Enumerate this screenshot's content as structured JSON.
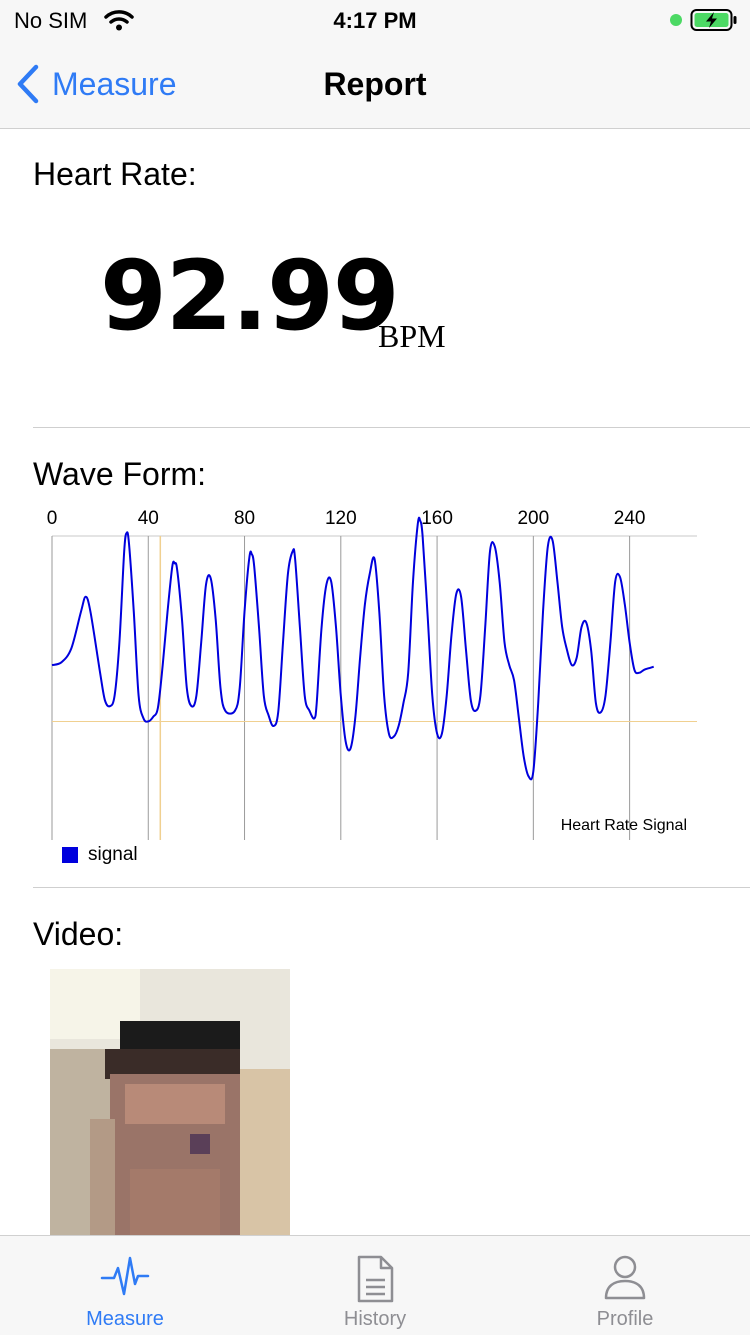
{
  "status_bar": {
    "carrier": "No SIM",
    "time": "4:17 PM"
  },
  "nav": {
    "back_label": "Measure",
    "title": "Report"
  },
  "heart_rate": {
    "label": "Heart Rate:",
    "value": "92.99",
    "unit": "BPM"
  },
  "wave_form": {
    "label": "Wave Form:"
  },
  "video": {
    "label": "Video:"
  },
  "chart_data": {
    "type": "line",
    "title": "Heart Rate Signal",
    "x_ticks": [
      0,
      40,
      80,
      120,
      160,
      200,
      240
    ],
    "xlim": [
      0,
      268
    ],
    "ylim": [
      -1.0,
      1.0
    ],
    "baseline": -0.22,
    "marker_x": 45,
    "legend_position": "bottom-left",
    "series": [
      {
        "name": "signal",
        "color": "#0000dd",
        "points": [
          [
            0,
            0.15
          ],
          [
            4,
            0.17
          ],
          [
            8,
            0.26
          ],
          [
            12,
            0.5
          ],
          [
            14,
            0.6
          ],
          [
            16,
            0.5
          ],
          [
            20,
            0.1
          ],
          [
            22,
            -0.08
          ],
          [
            24,
            -0.12
          ],
          [
            26,
            -0.05
          ],
          [
            28,
            0.3
          ],
          [
            30,
            0.9
          ],
          [
            31,
            1.02
          ],
          [
            32,
            0.95
          ],
          [
            34,
            0.5
          ],
          [
            36,
            -0.05
          ],
          [
            38,
            -0.2
          ],
          [
            40,
            -0.22
          ],
          [
            42,
            -0.19
          ],
          [
            44,
            -0.13
          ],
          [
            46,
            0.15
          ],
          [
            48,
            0.5
          ],
          [
            50,
            0.8
          ],
          [
            51,
            0.82
          ],
          [
            52,
            0.78
          ],
          [
            54,
            0.45
          ],
          [
            56,
            0.0
          ],
          [
            58,
            -0.12
          ],
          [
            60,
            -0.05
          ],
          [
            62,
            0.3
          ],
          [
            64,
            0.68
          ],
          [
            66,
            0.72
          ],
          [
            68,
            0.45
          ],
          [
            70,
            0.0
          ],
          [
            72,
            -0.15
          ],
          [
            76,
            -0.15
          ],
          [
            78,
            0.0
          ],
          [
            80,
            0.5
          ],
          [
            82,
            0.86
          ],
          [
            83,
            0.88
          ],
          [
            84,
            0.8
          ],
          [
            86,
            0.4
          ],
          [
            88,
            -0.05
          ],
          [
            90,
            -0.18
          ],
          [
            92,
            -0.25
          ],
          [
            94,
            -0.16
          ],
          [
            96,
            0.3
          ],
          [
            98,
            0.75
          ],
          [
            100,
            0.9
          ],
          [
            101,
            0.85
          ],
          [
            103,
            0.4
          ],
          [
            105,
            -0.05
          ],
          [
            107,
            -0.15
          ],
          [
            109,
            -0.2
          ],
          [
            110,
            -0.1
          ],
          [
            112,
            0.4
          ],
          [
            114,
            0.68
          ],
          [
            116,
            0.7
          ],
          [
            118,
            0.4
          ],
          [
            120,
            -0.05
          ],
          [
            122,
            -0.35
          ],
          [
            124,
            -0.4
          ],
          [
            126,
            -0.2
          ],
          [
            128,
            0.2
          ],
          [
            130,
            0.55
          ],
          [
            132,
            0.75
          ],
          [
            134,
            0.85
          ],
          [
            136,
            0.5
          ],
          [
            138,
            -0.05
          ],
          [
            140,
            -0.3
          ],
          [
            142,
            -0.32
          ],
          [
            144,
            -0.25
          ],
          [
            146,
            -0.1
          ],
          [
            148,
            0.1
          ],
          [
            150,
            0.7
          ],
          [
            152,
            1.08
          ],
          [
            153,
            1.1
          ],
          [
            154,
            1.0
          ],
          [
            156,
            0.5
          ],
          [
            158,
            -0.05
          ],
          [
            160,
            -0.3
          ],
          [
            162,
            -0.3
          ],
          [
            164,
            -0.05
          ],
          [
            166,
            0.35
          ],
          [
            168,
            0.62
          ],
          [
            170,
            0.6
          ],
          [
            172,
            0.25
          ],
          [
            174,
            -0.08
          ],
          [
            176,
            -0.15
          ],
          [
            178,
            -0.05
          ],
          [
            180,
            0.4
          ],
          [
            182,
            0.9
          ],
          [
            184,
            0.93
          ],
          [
            186,
            0.7
          ],
          [
            188,
            0.3
          ],
          [
            190,
            0.15
          ],
          [
            192,
            0.05
          ],
          [
            194,
            -0.2
          ],
          [
            196,
            -0.45
          ],
          [
            198,
            -0.58
          ],
          [
            200,
            -0.55
          ],
          [
            202,
            -0.1
          ],
          [
            204,
            0.5
          ],
          [
            206,
            0.93
          ],
          [
            208,
            0.97
          ],
          [
            210,
            0.7
          ],
          [
            212,
            0.4
          ],
          [
            214,
            0.25
          ],
          [
            216,
            0.15
          ],
          [
            218,
            0.2
          ],
          [
            220,
            0.4
          ],
          [
            222,
            0.43
          ],
          [
            224,
            0.25
          ],
          [
            226,
            -0.1
          ],
          [
            228,
            -0.16
          ],
          [
            230,
            -0.05
          ],
          [
            232,
            0.3
          ],
          [
            234,
            0.7
          ],
          [
            236,
            0.73
          ],
          [
            238,
            0.55
          ],
          [
            240,
            0.3
          ],
          [
            242,
            0.12
          ],
          [
            244,
            0.1
          ],
          [
            246,
            0.12
          ],
          [
            248,
            0.13
          ],
          [
            250,
            0.14
          ]
        ]
      }
    ]
  },
  "tabs": [
    {
      "label": "Measure",
      "icon": "heartbeat-icon",
      "active": true
    },
    {
      "label": "History",
      "icon": "document-icon",
      "active": false
    },
    {
      "label": "Profile",
      "icon": "person-icon",
      "active": false
    }
  ],
  "colors": {
    "accent": "#2f7bf5",
    "inactive": "#8e8e93",
    "signal": "#0000dd",
    "baseline": "#f0d090"
  }
}
